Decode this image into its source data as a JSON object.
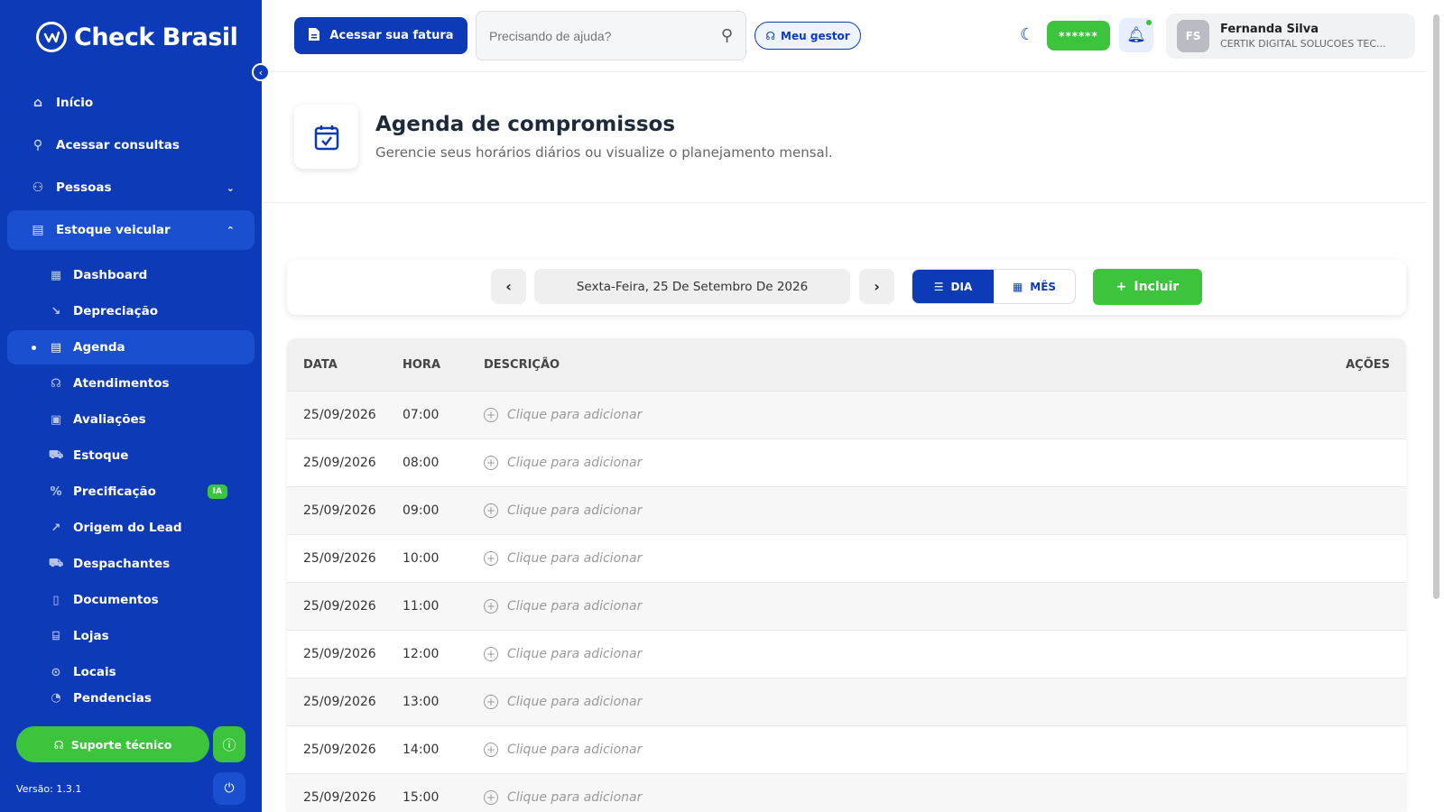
{
  "app": {
    "brand": "Check Brasil"
  },
  "sidebar": {
    "items": [
      {
        "label": "Início",
        "icon": "home-icon"
      },
      {
        "label": "Acessar consultas",
        "icon": "search-icon"
      },
      {
        "label": "Pessoas",
        "icon": "people-icon"
      },
      {
        "label": "Estoque veicular",
        "icon": "vehicle-icon"
      }
    ],
    "subitems": [
      {
        "label": "Dashboard"
      },
      {
        "label": "Depreciação"
      },
      {
        "label": "Agenda"
      },
      {
        "label": "Atendimentos"
      },
      {
        "label": "Avaliações"
      },
      {
        "label": "Estoque"
      },
      {
        "label": "Precificação",
        "badge": "IA"
      },
      {
        "label": "Origem do Lead"
      },
      {
        "label": "Despachantes"
      },
      {
        "label": "Documentos"
      },
      {
        "label": "Lojas"
      },
      {
        "label": "Locais"
      },
      {
        "label": "Pendencias"
      }
    ],
    "support_label": "Suporte técnico",
    "version": "Versão: 1.3.1"
  },
  "header": {
    "invoice_label": "Acessar sua fatura",
    "search_placeholder": "Precisando de ajuda?",
    "manager_label": "Meu gestor",
    "password_mask": "******",
    "user_name": "Fernanda Silva",
    "user_company": "CERTIK DIGITAL SOLUCOES TEC...",
    "user_initials": "FS"
  },
  "page": {
    "title": "Agenda de compromissos",
    "subtitle": "Gerencie seus horários diários ou visualize o planejamento mensal."
  },
  "toolbar": {
    "date_label": "Sexta-Feira, 25 De Setembro De 2026",
    "view_day": "DIA",
    "view_month": "MÊS",
    "add_label": "Incluir"
  },
  "table": {
    "headers": {
      "date": "DATA",
      "hour": "HORA",
      "desc": "DESCRIÇÃO",
      "actions": "AÇÕES"
    },
    "placeholder": "Clique para adicionar",
    "rows": [
      {
        "date": "25/09/2026",
        "hour": "07:00"
      },
      {
        "date": "25/09/2026",
        "hour": "08:00"
      },
      {
        "date": "25/09/2026",
        "hour": "09:00"
      },
      {
        "date": "25/09/2026",
        "hour": "10:00"
      },
      {
        "date": "25/09/2026",
        "hour": "11:00"
      },
      {
        "date": "25/09/2026",
        "hour": "12:00"
      },
      {
        "date": "25/09/2026",
        "hour": "13:00"
      },
      {
        "date": "25/09/2026",
        "hour": "14:00"
      },
      {
        "date": "25/09/2026",
        "hour": "15:00"
      }
    ]
  },
  "colors": {
    "primary": "#0d3bb8",
    "success": "#3cc53c"
  }
}
